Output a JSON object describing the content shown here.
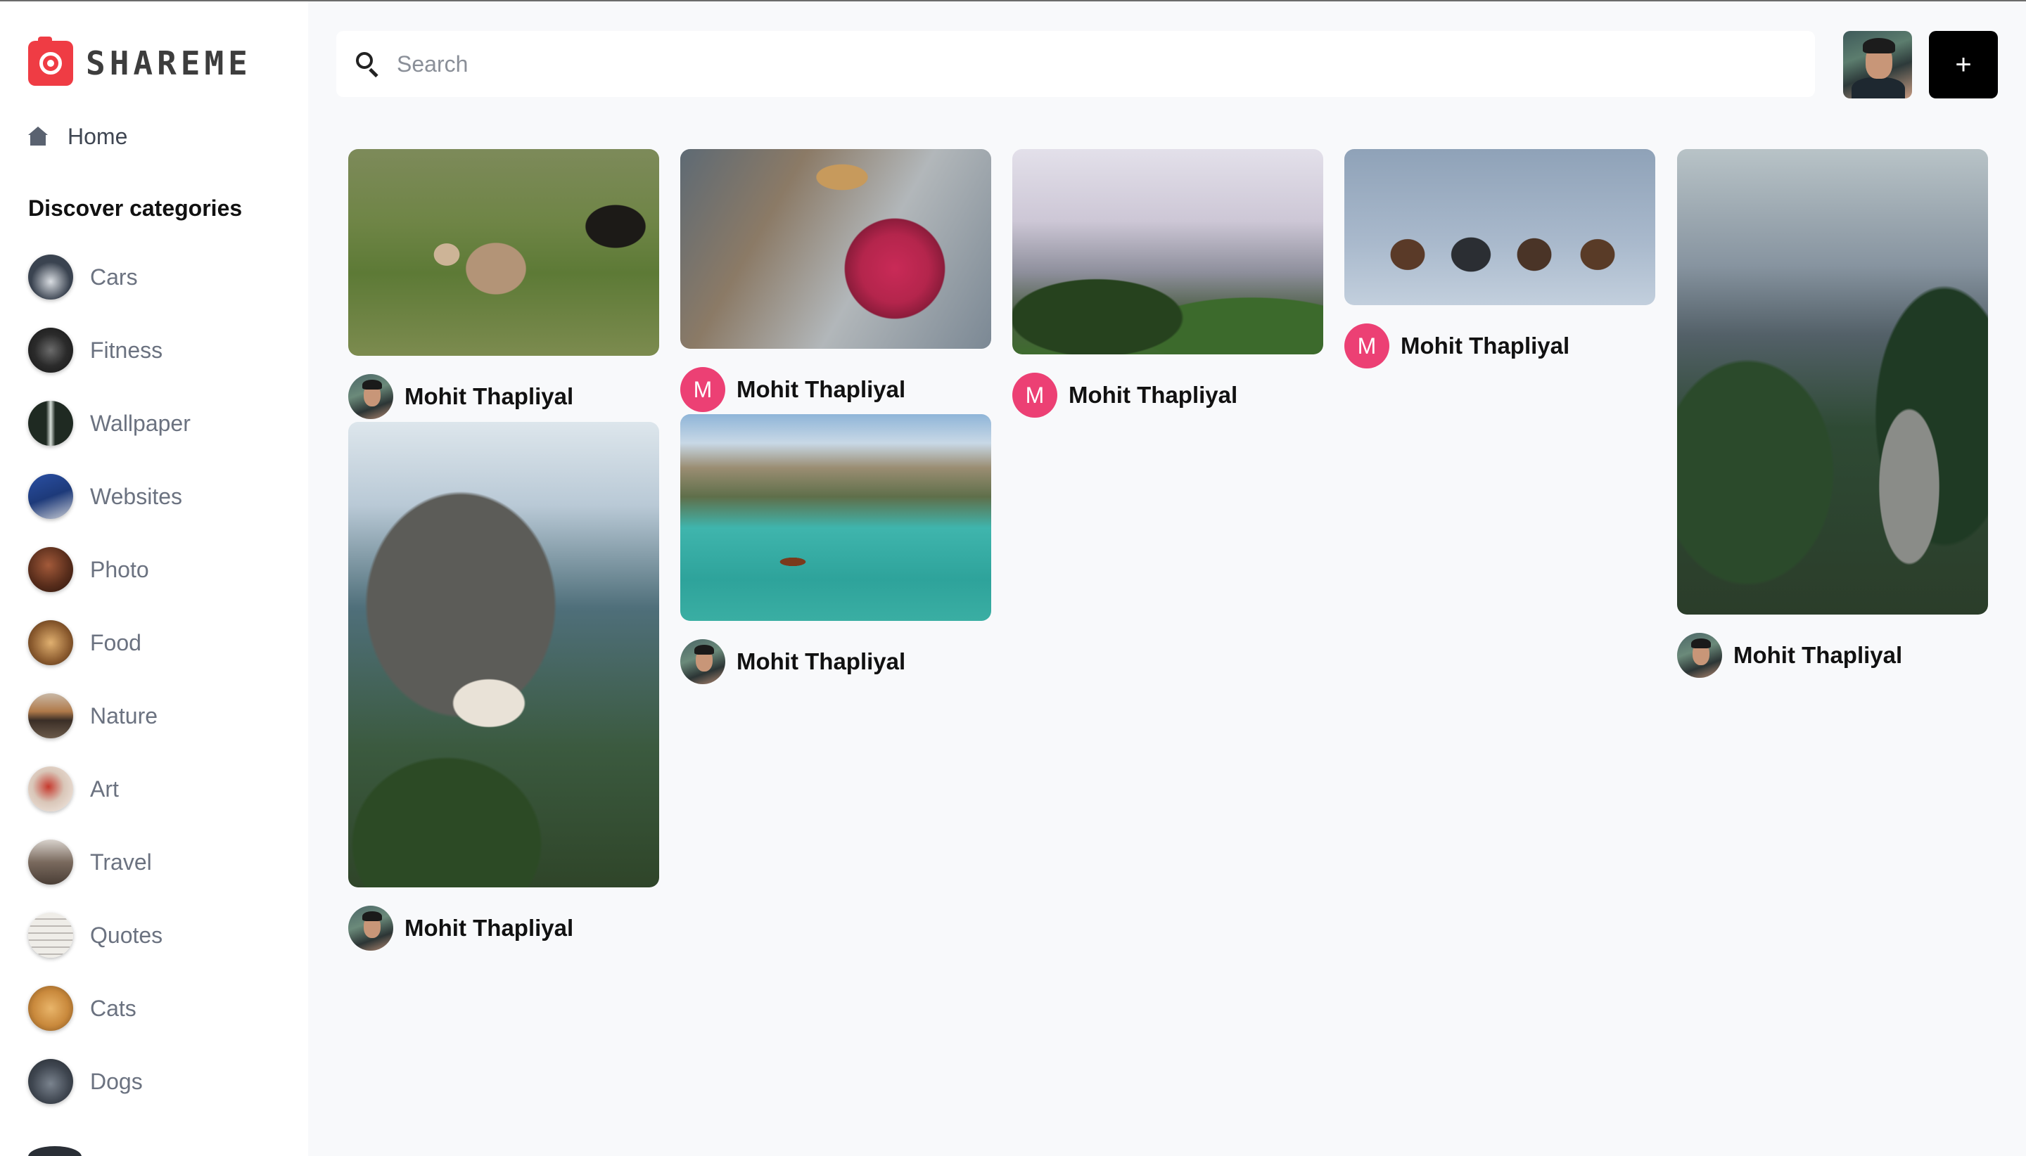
{
  "app": {
    "brand": "SHAREME",
    "accent": "#ef3c44",
    "avatar_pink": "#ec4074"
  },
  "sidebar": {
    "home_label": "Home",
    "categories_heading": "Discover categories",
    "categories": [
      {
        "label": "Cars",
        "avatar_color": "#3a4350"
      },
      {
        "label": "Fitness",
        "avatar_color": "#2b2b2b"
      },
      {
        "label": "Wallpaper",
        "avatar_color": "#1f2a22"
      },
      {
        "label": "Websites",
        "avatar_color": "#1d3a7a"
      },
      {
        "label": "Photo",
        "avatar_color": "#5a2e1c"
      },
      {
        "label": "Food",
        "avatar_color": "#8a5a2e"
      },
      {
        "label": "Nature",
        "avatar_color": "#6b5a4a"
      },
      {
        "label": "Art",
        "avatar_color": "#d9c6b8"
      },
      {
        "label": "Travel",
        "avatar_color": "#7a6a5e"
      },
      {
        "label": "Quotes",
        "avatar_color": "#efede8"
      },
      {
        "label": "Cats",
        "avatar_color": "#c9893c"
      },
      {
        "label": "Dogs",
        "avatar_color": "#3f4650"
      }
    ]
  },
  "header": {
    "search_placeholder": "Search",
    "add_label": "+"
  },
  "pins": [
    {
      "image": "yak",
      "author": "Mohit Thapliyal",
      "avatar_type": "photo"
    },
    {
      "image": "monastery",
      "author": "Mohit Thapliyal",
      "avatar_type": "photo"
    },
    {
      "image": "apple",
      "author": "Mohit Thapliyal",
      "avatar_type": "initial",
      "initial": "M"
    },
    {
      "image": "lake",
      "author": "Mohit Thapliyal",
      "avatar_type": "photo"
    },
    {
      "image": "mist",
      "author": "Mohit Thapliyal",
      "avatar_type": "initial",
      "initial": "M"
    },
    {
      "image": "bells",
      "author": "Mohit Thapliyal",
      "avatar_type": "initial",
      "initial": "M"
    },
    {
      "image": "forest-path",
      "author": "Mohit Thapliyal",
      "avatar_type": "photo"
    }
  ]
}
